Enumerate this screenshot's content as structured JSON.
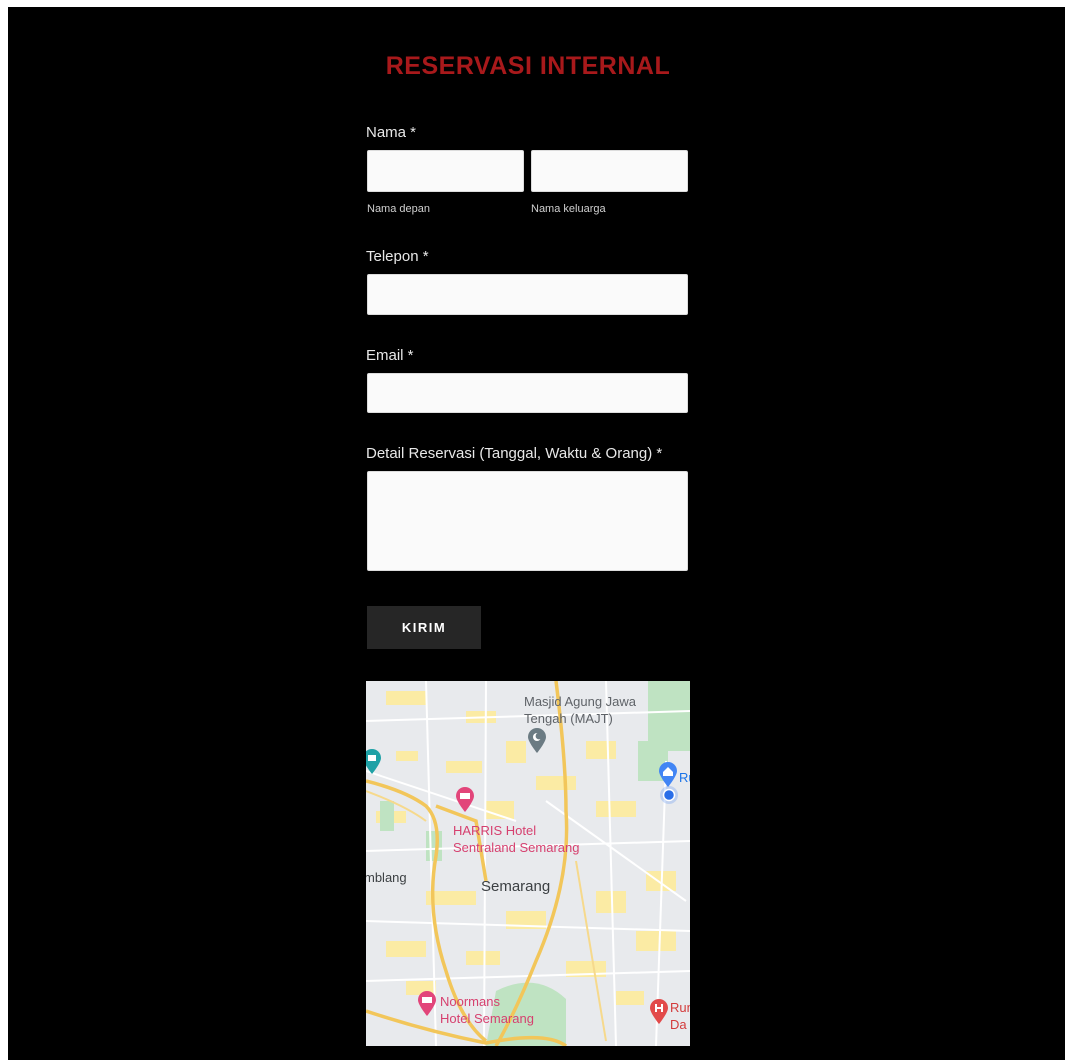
{
  "form": {
    "title": "RESERVASI INTERNAL",
    "name_label": "Nama *",
    "first_name_sublabel": "Nama depan",
    "last_name_sublabel": "Nama keluarga",
    "first_name_value": "",
    "last_name_value": "",
    "phone_label": "Telepon *",
    "phone_value": "",
    "email_label": "Email *",
    "email_value": "",
    "details_label": "Detail Reservasi (Tanggal, Waktu & Orang) *",
    "details_value": "",
    "submit_label": "KIRIM"
  },
  "map": {
    "labels": {
      "mosque_line1": "Masjid Agung Jawa",
      "mosque_line2": "Tengah (MAJT)",
      "harris_line1": "HARRIS Hotel",
      "harris_line2": "Sentraland Semarang",
      "city": "Semarang",
      "west_partial": "mblang",
      "noormans_line1": "Noormans",
      "noormans_line2": "Hotel Semarang",
      "ru_partial": "Ru",
      "rumah_line1": "Rum",
      "rumah_line2": "Da"
    },
    "pins": [
      "mosque-pin-icon",
      "hotel-pin-icon",
      "hospital-pin-icon",
      "home-pin-icon",
      "museum-pin-icon",
      "location-dot-icon"
    ]
  },
  "colors": {
    "background": "#000000",
    "title": "#a8191b",
    "button": "#262626",
    "hotel_pin": "#e2457a",
    "hospital_pin": "#e24a4a",
    "home_pin": "#4285f4",
    "museum_pin": "#1fa1a6",
    "mosque_pin": "#6b7b83",
    "road_major": "#f2c65a",
    "urban_patch": "#fbeba4",
    "park": "#bfe3c2"
  }
}
